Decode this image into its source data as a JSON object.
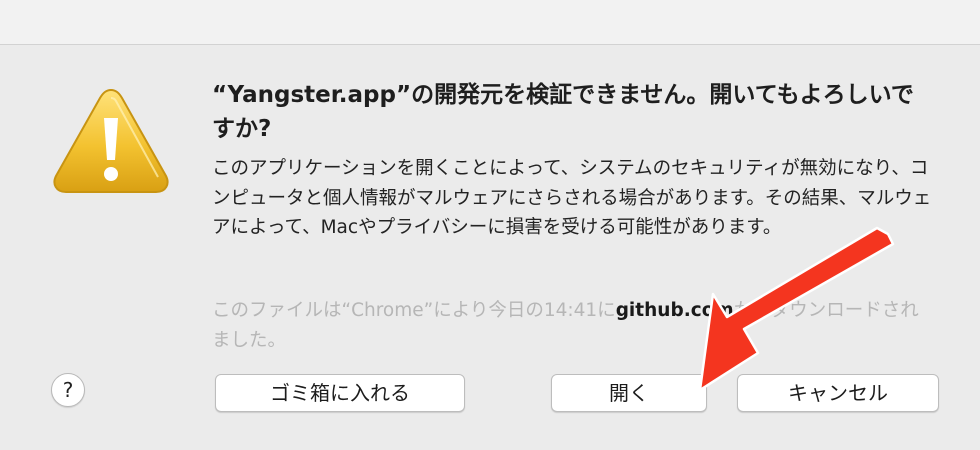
{
  "dialog": {
    "title": "“Yangster.app”の開発元を検証できません。開いてもよろしいですか?",
    "message": "このアプリケーションを開くことによって、システムのセキュリティが無効になり、コンピュータと個人情報がマルウェアにさらされる場合があります。その結果、マルウェアによって、Macやプライバシーに損害を受ける可能性があります。",
    "download_note": {
      "prefix": "このファイルは“Chrome”により今日の14:41に",
      "host": "github.com",
      "suffix": "からダウンロードされました。"
    },
    "icon": "warning-triangle-icon"
  },
  "buttons": {
    "help": "?",
    "move_to_trash": "ゴミ箱に入れる",
    "open": "開く",
    "cancel": "キャンセル"
  },
  "annotation": {
    "icon": "red-arrow-icon",
    "color": "#f4351f"
  }
}
